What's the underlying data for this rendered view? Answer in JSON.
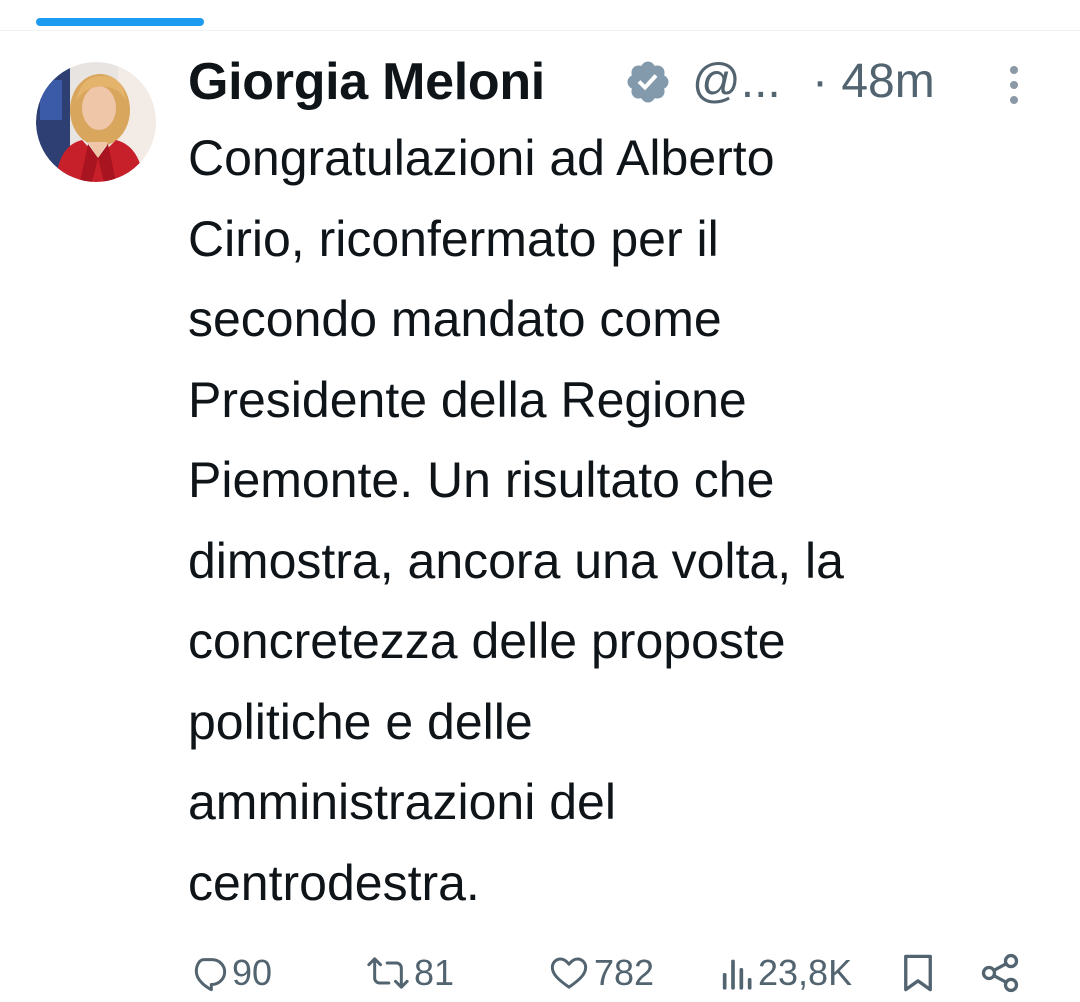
{
  "tweet": {
    "author": {
      "display_name": "Giorgia Meloni",
      "handle": "@...",
      "verified": true,
      "avatar_icon": "profile-photo"
    },
    "time_ago": "· 48m",
    "text_lines": [
      "Congratulazioni ad Alberto",
      "Cirio, riconfermato per il",
      "secondo mandato come",
      "Presidente della Regione",
      "Piemonte. Un risultato che",
      "dimostra, ancora una volta, la",
      "concretezza delle proposte",
      "politiche e delle",
      "amministrazioni del",
      "centrodestra."
    ],
    "stats": {
      "replies": "90",
      "retweets": "81",
      "likes": "782",
      "views": "23,8K"
    }
  },
  "icons": {
    "verified": "verified-badge-icon",
    "more": "more-vertical-icon",
    "reply": "reply-icon",
    "retweet": "retweet-icon",
    "like": "heart-icon",
    "views": "views-icon",
    "bookmark": "bookmark-icon",
    "share": "share-icon"
  },
  "colors": {
    "accent": "#1d9bf0",
    "text": "#0f1419",
    "secondary": "#536471",
    "verified_badge": "#829aab"
  }
}
